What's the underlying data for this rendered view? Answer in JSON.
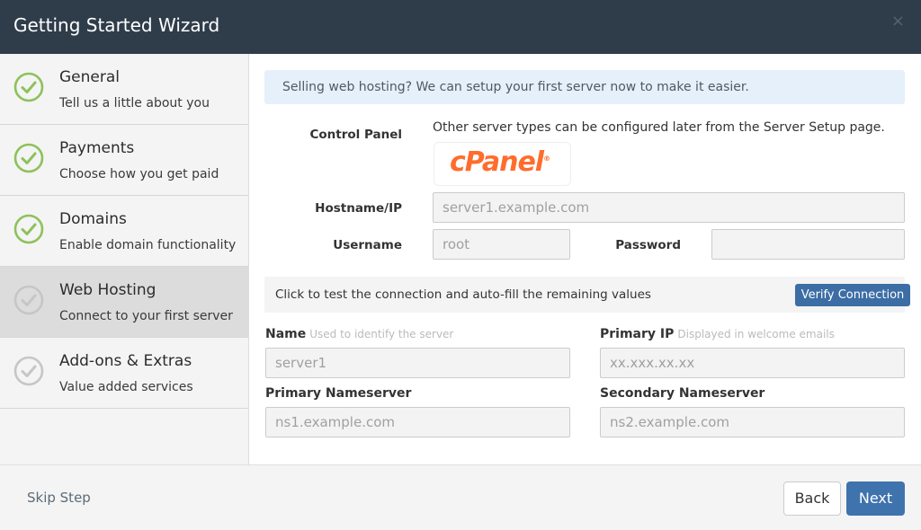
{
  "header": {
    "title": "Getting Started Wizard",
    "close_symbol": "×"
  },
  "sidebar": {
    "steps": [
      {
        "title": "General",
        "subtitle": "Tell us a little about you",
        "completed": true,
        "icon": "check-circle-icon"
      },
      {
        "title": "Payments",
        "subtitle": "Choose how you get paid",
        "completed": true,
        "icon": "check-circle-icon"
      },
      {
        "title": "Domains",
        "subtitle": "Enable domain functionality",
        "completed": true,
        "icon": "check-circle-icon"
      },
      {
        "title": "Web Hosting",
        "subtitle": "Connect to your first server",
        "completed": false,
        "active": true,
        "icon": "check-circle-icon"
      },
      {
        "title": "Add-ons & Extras",
        "subtitle": "Value added services",
        "completed": false,
        "icon": "check-circle-icon"
      }
    ]
  },
  "main": {
    "banner": "Selling web hosting? We can setup your first server now to make it easier.",
    "control_panel": {
      "label": "Control Panel",
      "note": "Other server types can be configured later from the Server Setup page.",
      "logo_text": "cPanel",
      "logo_reg": "®"
    },
    "hostname": {
      "label": "Hostname/IP",
      "placeholder": "server1.example.com"
    },
    "username": {
      "label": "Username",
      "placeholder": "root"
    },
    "password": {
      "label": "Password",
      "placeholder": ""
    },
    "test": {
      "text": "Click to test the connection and auto-fill the remaining values",
      "button": "Verify Connection"
    },
    "name": {
      "label": "Name",
      "help": "Used to identify the server",
      "placeholder": "server1"
    },
    "primary_ip": {
      "label": "Primary IP",
      "help": "Displayed in welcome emails",
      "placeholder": "xx.xxx.xx.xx"
    },
    "primary_ns": {
      "label": "Primary Nameserver",
      "placeholder": "ns1.example.com"
    },
    "secondary_ns": {
      "label": "Secondary Nameserver",
      "placeholder": "ns2.example.com"
    }
  },
  "footer": {
    "skip": "Skip Step",
    "back": "Back",
    "next": "Next"
  },
  "colors": {
    "header_bg": "#2f3d4b",
    "check_done": "#8ec15b",
    "check_pending": "#c6c6c6",
    "primary_button": "#3f73ad",
    "cpanel_orange": "#ff6c2c"
  }
}
